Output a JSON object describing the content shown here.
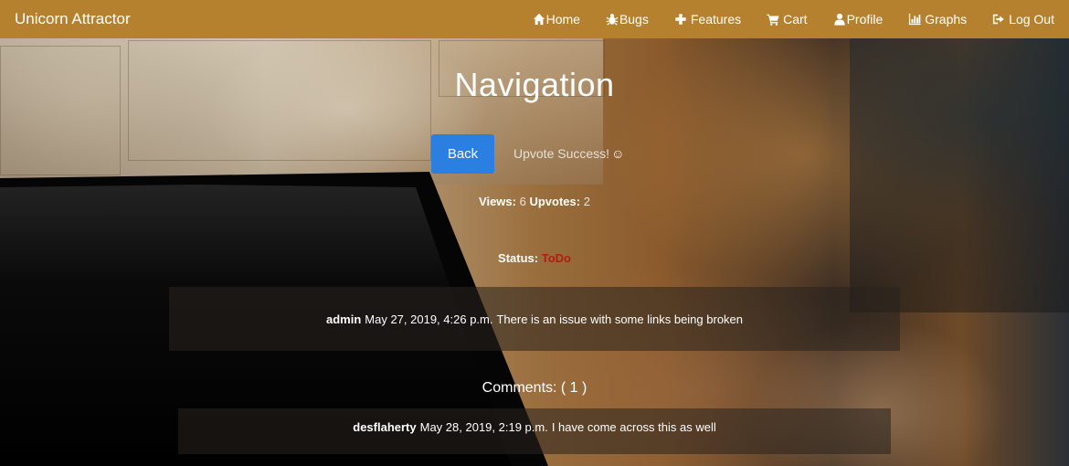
{
  "app": {
    "brand": "Unicorn Attractor"
  },
  "nav": {
    "items": [
      {
        "label": "Home",
        "icon": "home-icon"
      },
      {
        "label": "Bugs",
        "icon": "bug-icon"
      },
      {
        "label": "Features",
        "icon": "plus-icon"
      },
      {
        "label": "Cart",
        "icon": "cart-icon"
      },
      {
        "label": "Profile",
        "icon": "user-icon"
      },
      {
        "label": "Graphs",
        "icon": "bar-chart-icon"
      },
      {
        "label": "Log Out",
        "icon": "logout-icon"
      }
    ]
  },
  "page": {
    "title": "Navigation",
    "back_label": "Back",
    "upvote_message": "Upvote Success!",
    "upvote_emoji": "☺"
  },
  "stats": {
    "views_label": "Views:",
    "views_value": "6",
    "upvotes_label": "Upvotes:",
    "upvotes_value": "2"
  },
  "status": {
    "label": "Status:",
    "value": "ToDo",
    "color": "#b01e10"
  },
  "issue": {
    "author": "admin",
    "date": "May 27, 2019, 4:26 p.m.",
    "text": "There is an issue with some links being broken"
  },
  "comments": {
    "heading": "Comments: ( 1 )",
    "items": [
      {
        "author": "desflaherty",
        "date": "May 28, 2019, 2:19 p.m.",
        "text": "I have come across this as well"
      }
    ]
  },
  "colors": {
    "navbar": "#b6812f",
    "button": "#2a7fe0"
  }
}
